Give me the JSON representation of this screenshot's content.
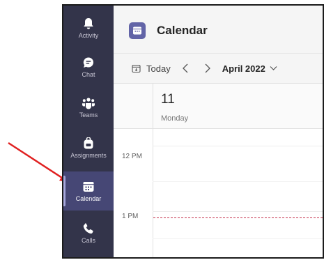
{
  "rail": {
    "items": [
      {
        "label": "Activity",
        "icon": "bell-icon"
      },
      {
        "label": "Chat",
        "icon": "chat-icon"
      },
      {
        "label": "Teams",
        "icon": "teams-icon"
      },
      {
        "label": "Assignments",
        "icon": "backpack-icon"
      },
      {
        "label": "Calendar",
        "icon": "calendar-icon",
        "active": true
      },
      {
        "label": "Calls",
        "icon": "phone-icon"
      }
    ]
  },
  "header": {
    "title": "Calendar"
  },
  "toolbar": {
    "today_label": "Today",
    "month_label": "April 2022"
  },
  "day": {
    "number": "11",
    "name": "Monday"
  },
  "times": {
    "t12": "12 PM",
    "t1": "1 PM"
  },
  "colors": {
    "rail_bg": "#33344a",
    "accent": "#6264a7",
    "now_line": "#c4314b",
    "annotation_arrow": "#e02020"
  }
}
